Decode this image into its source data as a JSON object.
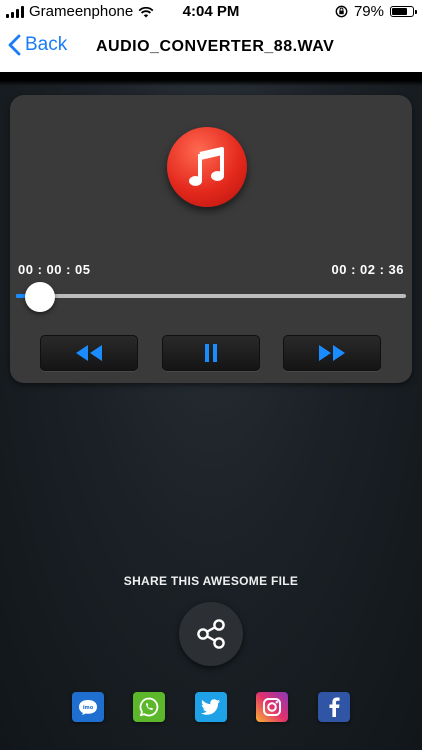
{
  "status_bar": {
    "carrier": "Grameenphone",
    "time": "4:04 PM",
    "battery_percent": "79%",
    "battery_level": 0.79
  },
  "nav": {
    "back_label": "Back",
    "title": "AUDIO_CONVERTER_88.WAV"
  },
  "player": {
    "current_time": "00 : 00 : 05",
    "total_time": "00 : 02 : 36",
    "progress": 0.032,
    "controls": [
      "rewind",
      "pause",
      "fast-forward"
    ]
  },
  "share": {
    "label": "SHARE THIS AWESOME FILE",
    "apps": [
      "imo",
      "WhatsApp",
      "Twitter",
      "Instagram",
      "Facebook"
    ]
  },
  "icons": {
    "music": "music-note-icon",
    "share": "share-icon"
  },
  "colors": {
    "accent": "#1a8cff",
    "ios_blue": "#1a7cf6",
    "music_red": "#e4291d",
    "card_bg": "#3a3a3b"
  }
}
